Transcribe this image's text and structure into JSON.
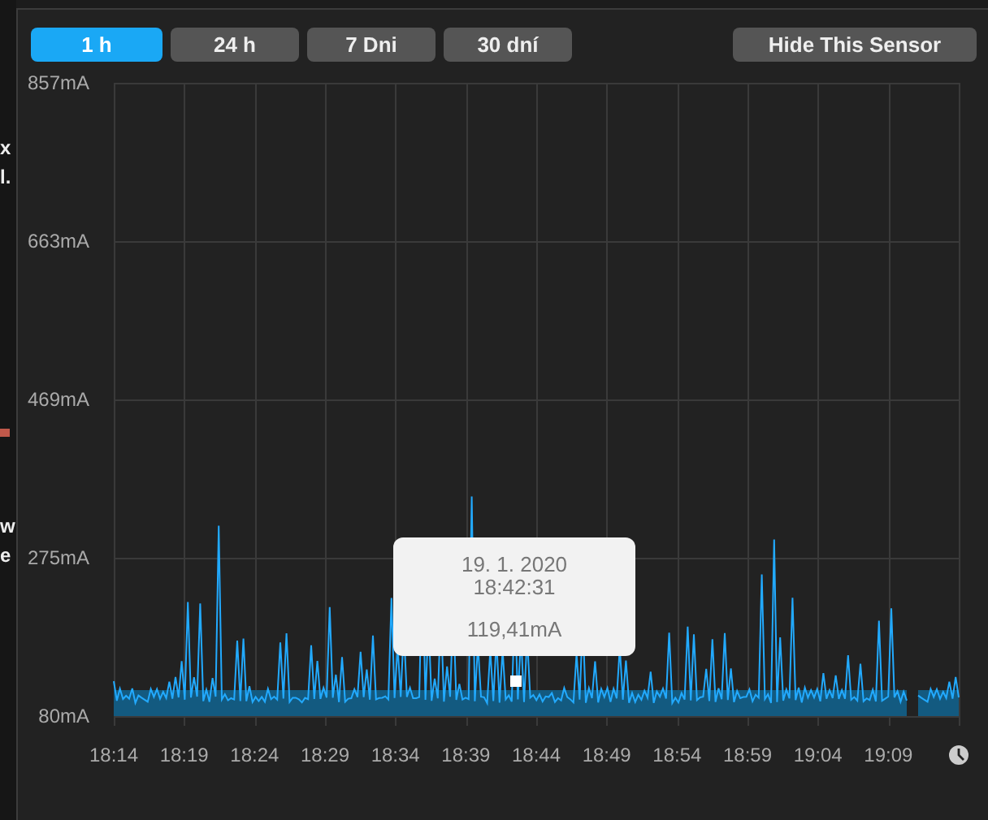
{
  "background_window": {
    "fragments": [
      "x",
      "l.",
      "w",
      "e"
    ]
  },
  "range_buttons": [
    {
      "label": "1 h",
      "selected": true
    },
    {
      "label": "24 h",
      "selected": false
    },
    {
      "label": "7 Dni",
      "selected": false
    },
    {
      "label": "30 dní",
      "selected": false
    }
  ],
  "hide_button": {
    "label": "Hide This Sensor"
  },
  "chart": {
    "y_labels": [
      "857mA",
      "663mA",
      "469mA",
      "275mA",
      "80mA"
    ],
    "x_labels": [
      "18:14",
      "18:19",
      "18:24",
      "18:29",
      "18:34",
      "18:39",
      "18:44",
      "18:49",
      "18:54",
      "18:59",
      "19:04",
      "19:09"
    ],
    "tooltip": {
      "date": "19. 1. 2020",
      "time": "18:42:31",
      "value": "119,41mA"
    }
  }
}
